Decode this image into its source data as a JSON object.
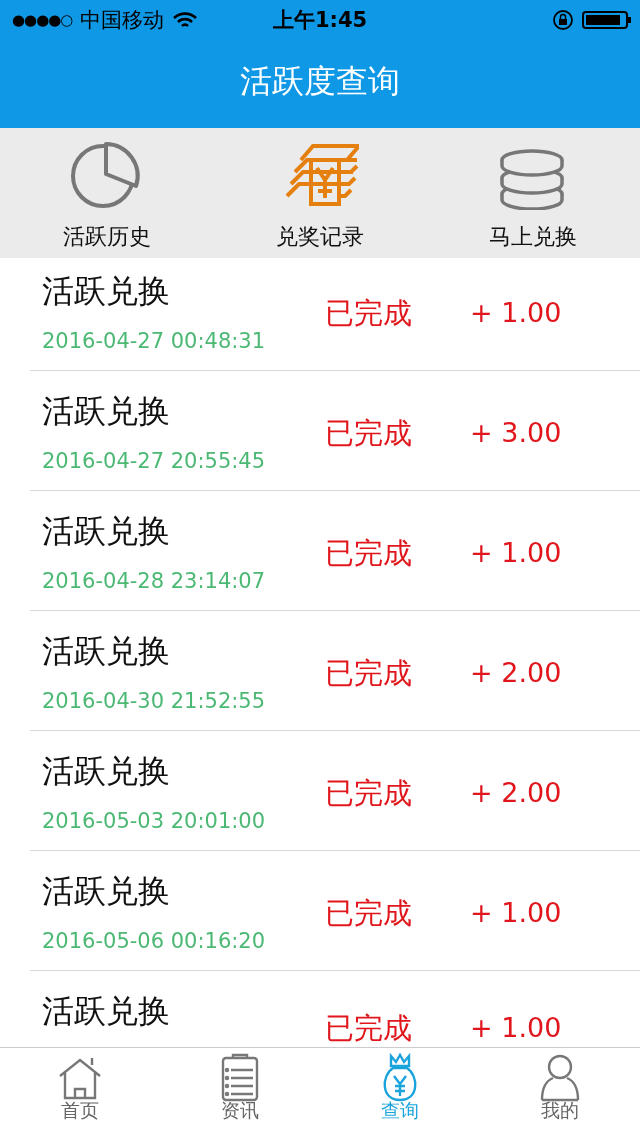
{
  "status_bar": {
    "signal": "●●●●○",
    "carrier": "中国移动",
    "time": "上午1:45"
  },
  "nav": {
    "title": "活跃度查询"
  },
  "segments": [
    {
      "label": "活跃历史",
      "kind": "pie",
      "selected": false
    },
    {
      "label": "兑奖记录",
      "kind": "money",
      "selected": true
    },
    {
      "label": "马上兑换",
      "kind": "coins",
      "selected": false
    }
  ],
  "records": [
    {
      "title": "活跃兑换",
      "time": "2016-04-27 00:48:31",
      "status": "已完成",
      "amount": "+ 1.00"
    },
    {
      "title": "活跃兑换",
      "time": "2016-04-27 20:55:45",
      "status": "已完成",
      "amount": "+ 3.00"
    },
    {
      "title": "活跃兑换",
      "time": "2016-04-28 23:14:07",
      "status": "已完成",
      "amount": "+ 1.00"
    },
    {
      "title": "活跃兑换",
      "time": "2016-04-30 21:52:55",
      "status": "已完成",
      "amount": "+ 2.00"
    },
    {
      "title": "活跃兑换",
      "time": "2016-05-03 20:01:00",
      "status": "已完成",
      "amount": "+ 2.00"
    },
    {
      "title": "活跃兑换",
      "time": "2016-05-06 00:16:20",
      "status": "已完成",
      "amount": "+ 1.00"
    },
    {
      "title": "活跃兑换",
      "status": "已完成",
      "amount": "+ 1.00"
    }
  ],
  "tab_bar": [
    {
      "label": "首页",
      "kind": "home",
      "selected": false
    },
    {
      "label": "资讯",
      "kind": "news",
      "selected": false
    },
    {
      "label": "查询",
      "kind": "bag",
      "selected": true
    },
    {
      "label": "我的",
      "kind": "person",
      "selected": false
    }
  ]
}
